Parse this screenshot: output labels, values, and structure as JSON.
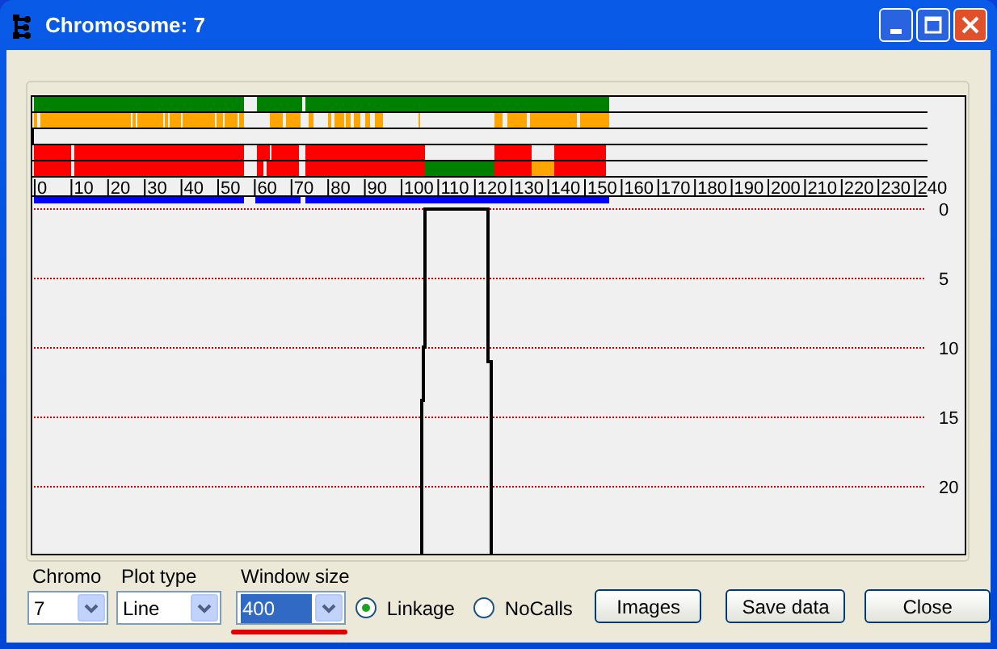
{
  "window": {
    "title": "Chromosome: 7"
  },
  "plot": {
    "scale_labels": [
      "0",
      "10",
      "20",
      "30",
      "40",
      "50",
      "60",
      "70",
      "80",
      "90",
      "100",
      "110",
      "120",
      "130",
      "140",
      "150",
      "160",
      "170",
      "180",
      "190",
      "200",
      "210",
      "220",
      "230",
      "240"
    ],
    "depth_labels": [
      "0",
      "5",
      "10",
      "15",
      "20"
    ]
  },
  "controls": [
    {
      "label": "Chromo",
      "value": "7",
      "highlighted": false
    },
    {
      "label": "Plot type",
      "value": "Line",
      "highlighted": false
    },
    {
      "label": "Window size",
      "value": "400",
      "highlighted": true
    }
  ],
  "radios": [
    {
      "label": "Linkage",
      "selected": true
    },
    {
      "label": "NoCalls",
      "selected": false
    }
  ],
  "buttons": [
    "Images",
    "Save data",
    "Close"
  ]
}
